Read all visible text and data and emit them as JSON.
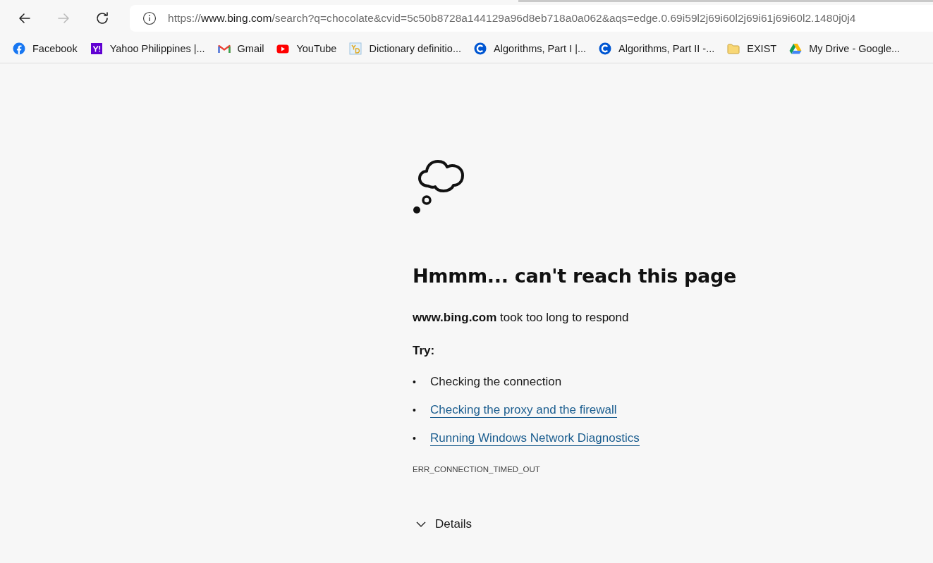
{
  "toolbar": {
    "nav_buttons": [
      {
        "kind": "back",
        "disabled": false
      },
      {
        "kind": "forward",
        "disabled": true
      },
      {
        "kind": "refresh",
        "disabled": false
      }
    ],
    "address_bar": {
      "scheme": "https://",
      "host": "www.bing.com",
      "path": "/search?q=chocolate&cvid=5c50b8728a144129a96d8eb718a0a062&aqs=edge.0.69i59l2j69i60l2j69i61j69i60l2.1480j0j4"
    }
  },
  "bookmarks": [
    {
      "label": "Facebook",
      "kind": "facebook"
    },
    {
      "label": "Yahoo Philippines |...",
      "kind": "yahoo"
    },
    {
      "label": "Gmail",
      "kind": "gmail"
    },
    {
      "label": "YouTube",
      "kind": "youtube"
    },
    {
      "label": "Dictionary definitio...",
      "kind": "dictionary"
    },
    {
      "label": "Algorithms, Part I |...",
      "kind": "coursera"
    },
    {
      "label": "Algorithms, Part II -...",
      "kind": "coursera"
    },
    {
      "label": "EXIST",
      "kind": "folder"
    },
    {
      "label": "My Drive - Google...",
      "kind": "drive"
    }
  ],
  "error_page": {
    "heading": "Hmmm... can't reach this page",
    "message": "**www.bing.com** took too long to respond",
    "try_label": "Try:",
    "suggestions": [
      {
        "bullet": "•",
        "text": "Checking the connection",
        "kind": "text"
      },
      {
        "bullet": "•",
        "text": "Checking the proxy and the firewall",
        "kind": "link"
      },
      {
        "bullet": "•",
        "text": "Running Windows Network Diagnostics",
        "kind": "link"
      }
    ],
    "error_code": "ERR_CONNECTION_TIMED_OUT",
    "details": {
      "label": "Details",
      "expanded": false
    }
  }
}
